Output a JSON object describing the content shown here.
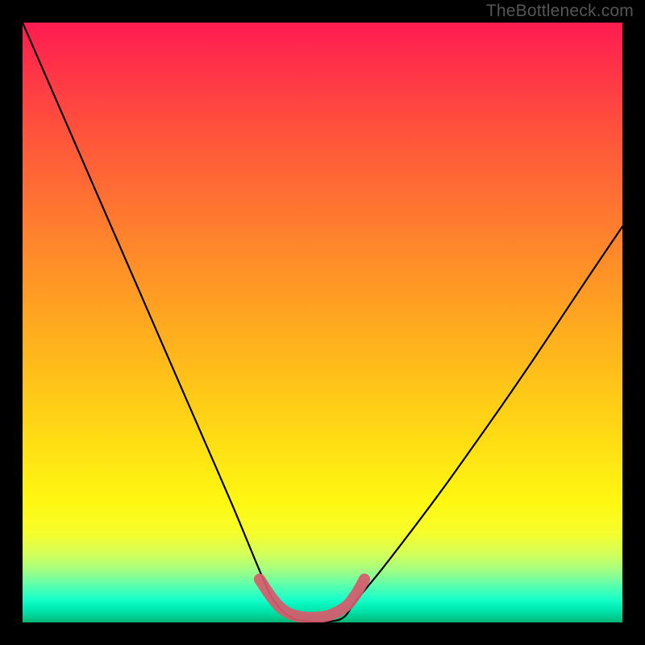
{
  "watermark": "TheBottleneck.com",
  "colors": {
    "page_bg": "#000000",
    "curve": "#000000",
    "trough_highlight": "#d85a6d",
    "gradient_stops": [
      "#ff1b51",
      "#ff2e4a",
      "#ff4640",
      "#ff5d38",
      "#ff7830",
      "#ff9326",
      "#ffae1e",
      "#ffc918",
      "#ffe313",
      "#fff812",
      "#f6fd2a",
      "#d6ff58",
      "#9dff87",
      "#55ffb0",
      "#18ffca",
      "#00f0b8",
      "#00e2a8",
      "#00d598",
      "#00c98b",
      "#00be7f",
      "#00b576"
    ]
  },
  "chart_data": {
    "type": "line",
    "title": "",
    "xlabel": "",
    "ylabel": "",
    "xlim": [
      0,
      1
    ],
    "ylim": [
      0,
      1
    ],
    "series": [
      {
        "name": "bottleneck-curve",
        "x": [
          0.0,
          0.05,
          0.1,
          0.15,
          0.2,
          0.25,
          0.3,
          0.35,
          0.4,
          0.42,
          0.445,
          0.475,
          0.515,
          0.537,
          0.555,
          0.6,
          0.65,
          0.7,
          0.75,
          0.8,
          0.85,
          0.9,
          0.95,
          1.0
        ],
        "y": [
          1.0,
          0.885,
          0.77,
          0.655,
          0.54,
          0.425,
          0.31,
          0.195,
          0.075,
          0.035,
          0.01,
          0.002,
          0.002,
          0.01,
          0.035,
          0.09,
          0.155,
          0.222,
          0.292,
          0.363,
          0.436,
          0.511,
          0.586,
          0.66
        ]
      },
      {
        "name": "trough-highlight",
        "x": [
          0.395,
          0.415,
          0.432,
          0.452,
          0.48,
          0.512,
          0.538,
          0.555,
          0.57
        ],
        "y": [
          0.072,
          0.042,
          0.023,
          0.012,
          0.008,
          0.012,
          0.026,
          0.046,
          0.072
        ]
      }
    ]
  }
}
